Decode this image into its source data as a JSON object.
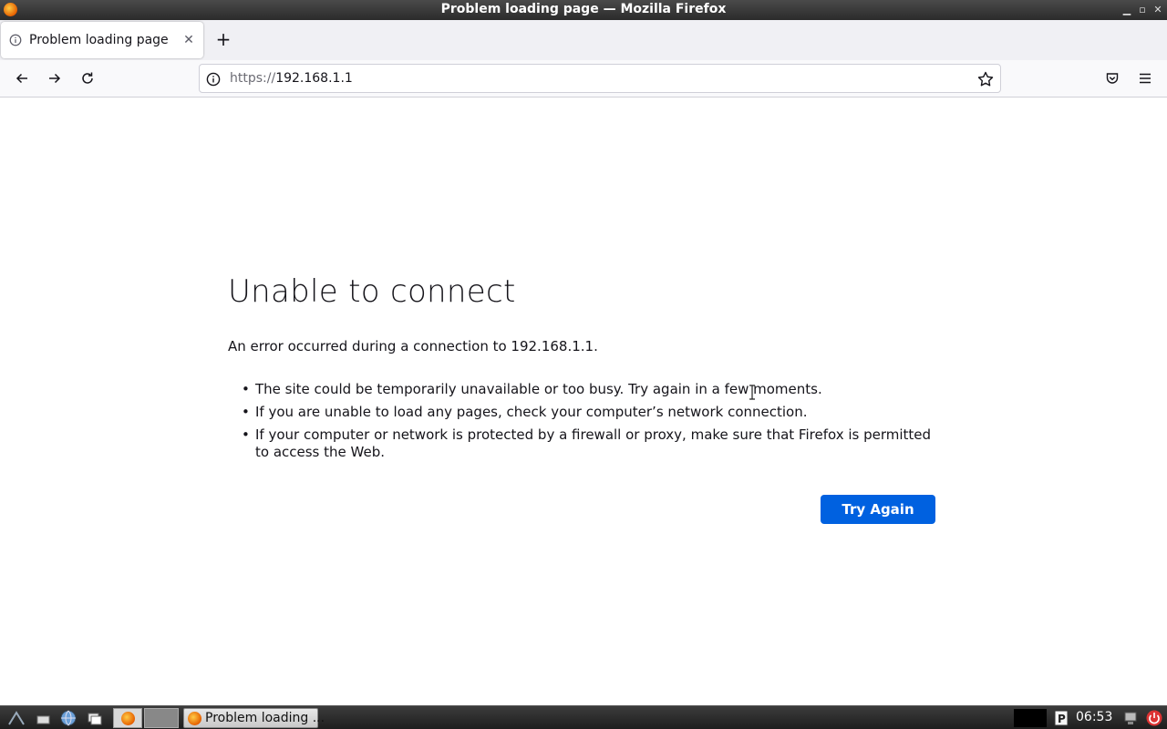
{
  "window": {
    "title": "Problem loading page — Mozilla Firefox",
    "controls": [
      "minimize",
      "maximize",
      "close"
    ]
  },
  "tabs": [
    {
      "label": "Problem loading page",
      "icon": "info-icon",
      "active": true
    }
  ],
  "toolbar": {
    "new_tab_label": "+",
    "back_icon": "back-arrow-icon",
    "forward_icon": "forward-arrow-icon",
    "reload_icon": "reload-icon",
    "pocket_icon": "pocket-icon",
    "menu_icon": "hamburger-menu-icon"
  },
  "urlbar": {
    "scheme": "https://",
    "host": "192.168.1.1",
    "bookmark_icon": "star-icon"
  },
  "error_page": {
    "title": "Unable to connect",
    "description": "An error occurred during a connection to 192.168.1.1.",
    "bullets": [
      "The site could be temporarily unavailable or too busy. Try again in a few moments.",
      "If you are unable to load any pages, check your computer’s network connection.",
      "If your computer or network is protected by a firewall or proxy, make sure that Firefox is permitted to access the Web."
    ],
    "button_label": "Try Again",
    "button_color": "#0061e0"
  },
  "taskbar": {
    "task_label": "Problem loading ...",
    "clock": "06:53",
    "launchers": [
      "start-menu-icon",
      "file-manager-icon",
      "web-browser-icon",
      "window-list-icon",
      "firefox-icon"
    ],
    "tray": [
      "pager-icon",
      "network-icon",
      "power-icon"
    ]
  }
}
